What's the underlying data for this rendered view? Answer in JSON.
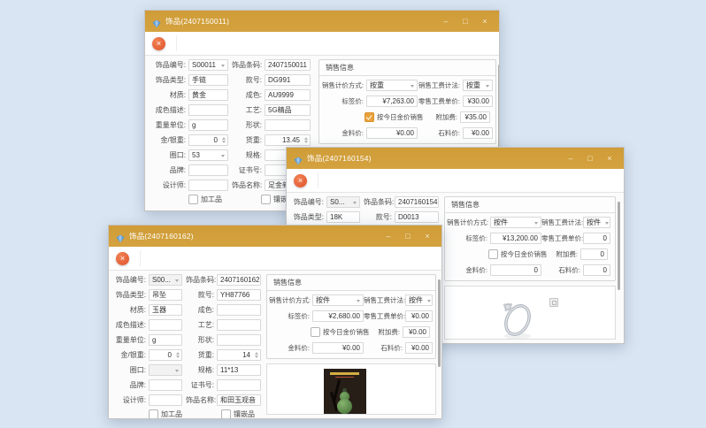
{
  "colors": {
    "titlebar": "#d4a23e",
    "desktop_background": "#d9e5f2",
    "cancel_button": "#e2512b",
    "checkbox_checked": "#e9a23b",
    "group_border": "#d6d6d6"
  },
  "chrome": {
    "minimize": "–",
    "maximize": "□",
    "close": "×",
    "cancel": "×"
  },
  "windows": [
    {
      "title": "饰品(2407150011)",
      "fields": [
        [
          {
            "label": "饰品编号",
            "value": "S00011",
            "kind": "combo"
          },
          {
            "label": "饰品条码",
            "value": "2407150011",
            "kind": "input"
          }
        ],
        [
          {
            "label": "饰品类型",
            "value": "手链",
            "kind": "input"
          },
          {
            "label": "款号",
            "value": "DG991",
            "kind": "input"
          }
        ],
        [
          {
            "label": "材质",
            "value": "黄金",
            "kind": "input"
          },
          {
            "label": "成色",
            "value": "AU9999",
            "kind": "input"
          }
        ],
        [
          {
            "label": "成色描述",
            "value": "",
            "kind": "input"
          },
          {
            "label": "工艺",
            "value": "5G精品",
            "kind": "input"
          }
        ],
        [
          {
            "label": "重量单位",
            "value": "g",
            "kind": "input"
          },
          {
            "label": "形状",
            "value": "",
            "kind": "input"
          }
        ],
        [
          {
            "label": "金/银重",
            "value": "0",
            "kind": "spin"
          },
          {
            "label": "货重",
            "value": "13.45",
            "kind": "spin"
          }
        ],
        [
          {
            "label": "圈口",
            "value": "53",
            "kind": "combo"
          },
          {
            "label": "规格",
            "value": "",
            "kind": "input"
          }
        ],
        [
          {
            "label": "品牌",
            "value": "",
            "kind": "input"
          },
          {
            "label": "证书号",
            "value": "",
            "kind": "input"
          }
        ],
        [
          {
            "label": "设计师",
            "value": "",
            "kind": "input"
          },
          {
            "label": "饰品名称",
            "value": "足金新款手链",
            "kind": "input"
          }
        ]
      ],
      "flags": [
        {
          "label": "加工品",
          "checked": false
        },
        {
          "label": "镶嵌品",
          "checked": false
        }
      ],
      "sales": {
        "title": "销售信息",
        "rows": [
          [
            {
              "label": "销售计价方式",
              "value": "按重",
              "kind": "combo"
            },
            {
              "label": "销售工费计法",
              "value": "按重",
              "kind": "combo"
            }
          ],
          [
            {
              "label": "标签价",
              "value": "¥7,263.00",
              "kind": "price"
            },
            {
              "label": "零售工费单价",
              "value": "¥30.00",
              "kind": "price"
            }
          ],
          [
            {
              "label": "按今日金价销售",
              "checked": true,
              "kind": "check"
            },
            {
              "label": "附加费",
              "value": "¥35.00",
              "kind": "price"
            }
          ],
          [
            {
              "label": "金料价",
              "value": "¥0.00",
              "kind": "price"
            },
            {
              "label": "石料价",
              "value": "¥0.00",
              "kind": "price"
            }
          ]
        ]
      }
    },
    {
      "title": "饰品(2407160154)",
      "fields": [
        [
          {
            "label": "饰品编号",
            "value": "S0...",
            "kind": "combo-disabled"
          },
          {
            "label": "饰品条码",
            "value": "2407160154",
            "kind": "input"
          }
        ],
        [
          {
            "label": "饰品类型",
            "value": "18K",
            "kind": "input"
          },
          {
            "label": "款号",
            "value": "D0013",
            "kind": "input"
          }
        ]
      ],
      "flags": null,
      "sales": {
        "title": "销售信息",
        "rows": [
          [
            {
              "label": "销售计价方式",
              "value": "按件",
              "kind": "combo"
            },
            {
              "label": "销售工费计法",
              "value": "按件",
              "kind": "combo"
            }
          ],
          [
            {
              "label": "标签价",
              "value": "¥13,200.00",
              "kind": "price"
            },
            {
              "label": "零售工费单价",
              "value": "0",
              "kind": "price"
            }
          ],
          [
            {
              "label": "按今日金价销售",
              "checked": false,
              "kind": "check"
            },
            {
              "label": "附加费",
              "value": "0",
              "kind": "price"
            }
          ],
          [
            {
              "label": "金料价",
              "value": "0",
              "kind": "price"
            },
            {
              "label": "石料价",
              "value": "0",
              "kind": "price"
            }
          ]
        ]
      },
      "image": "ring-photo"
    },
    {
      "title": "饰品(2407160162)",
      "fields": [
        [
          {
            "label": "饰品编号",
            "value": "S00...",
            "kind": "combo-disabled"
          },
          {
            "label": "饰品条码",
            "value": "2407160162",
            "kind": "input"
          }
        ],
        [
          {
            "label": "饰品类型",
            "value": "吊坠",
            "kind": "input"
          },
          {
            "label": "款号",
            "value": "YH87766",
            "kind": "input"
          }
        ],
        [
          {
            "label": "材质",
            "value": "玉器",
            "kind": "input"
          },
          {
            "label": "成色",
            "value": "",
            "kind": "input"
          }
        ],
        [
          {
            "label": "成色描述",
            "value": "",
            "kind": "input"
          },
          {
            "label": "工艺",
            "value": "",
            "kind": "input"
          }
        ],
        [
          {
            "label": "重量单位",
            "value": "g",
            "kind": "input"
          },
          {
            "label": "形状",
            "value": "",
            "kind": "input"
          }
        ],
        [
          {
            "label": "金/银重",
            "value": "0",
            "kind": "spin"
          },
          {
            "label": "货重",
            "value": "14",
            "kind": "spin"
          }
        ],
        [
          {
            "label": "圈口",
            "value": "",
            "kind": "combo-disabled"
          },
          {
            "label": "规格",
            "value": "11*13",
            "kind": "input"
          }
        ],
        [
          {
            "label": "品牌",
            "value": "",
            "kind": "input"
          },
          {
            "label": "证书号",
            "value": "",
            "kind": "input"
          }
        ],
        [
          {
            "label": "设计师",
            "value": "",
            "kind": "input"
          },
          {
            "label": "饰品名称",
            "value": "和田玉观音",
            "kind": "input"
          }
        ]
      ],
      "flags": [
        {
          "label": "加工品",
          "checked": false
        },
        {
          "label": "镶嵌品",
          "checked": false
        }
      ],
      "sales": {
        "title": "销售信息",
        "rows": [
          [
            {
              "label": "销售计价方式",
              "value": "按件",
              "kind": "combo"
            },
            {
              "label": "销售工费计法",
              "value": "按件",
              "kind": "combo"
            }
          ],
          [
            {
              "label": "标签价",
              "value": "¥2,680.00",
              "kind": "price"
            },
            {
              "label": "零售工费单价",
              "value": "¥0.00",
              "kind": "price"
            }
          ],
          [
            {
              "label": "按今日金价销售",
              "checked": false,
              "kind": "check"
            },
            {
              "label": "附加费",
              "value": "¥0.00",
              "kind": "price"
            }
          ],
          [
            {
              "label": "金料价",
              "value": "¥0.00",
              "kind": "price"
            },
            {
              "label": "石料价",
              "value": "¥0.00",
              "kind": "price"
            }
          ]
        ]
      },
      "image": "jade-pendant-photo"
    }
  ]
}
